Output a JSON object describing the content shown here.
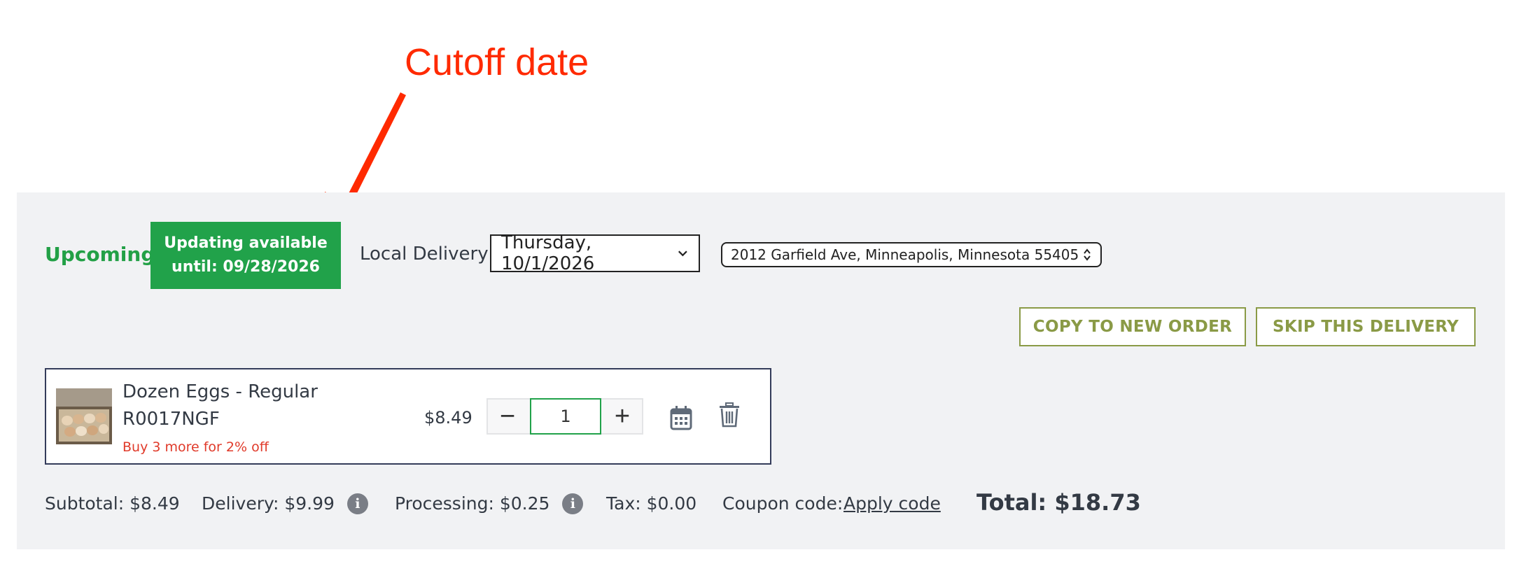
{
  "annotation": {
    "label": "Cutoff date",
    "color": "#ff2a00"
  },
  "order": {
    "status": "Upcoming",
    "cutoff_line1": "Updating available",
    "cutoff_line2": "until: 09/28/2026",
    "delivery_type": "Local Delivery",
    "delivery_date": "Thursday, 10/1/2026",
    "address": "2012 Garfield Ave, Minneapolis, Minnesota 55405"
  },
  "actions": {
    "copy_label": "COPY TO NEW ORDER",
    "skip_label": "SKIP THIS DELIVERY"
  },
  "item": {
    "name": "Dozen Eggs - Regular",
    "sku": "R0017NGF",
    "promo": "Buy 3 more for 2% off",
    "price": "$8.49",
    "quantity": "1",
    "minus": "−",
    "plus": "+"
  },
  "summary": {
    "subtotal": "Subtotal: $8.49",
    "delivery": "Delivery: $9.99",
    "processing": "Processing: $0.25",
    "tax": "Tax: $0.00",
    "coupon_label": "Coupon code:",
    "coupon_link": "Apply code",
    "total": "Total: $18.73",
    "info_glyph": "i"
  },
  "colors": {
    "brand_green": "#21a24a",
    "olive": "#8a9a46",
    "promo_red": "#e03a2a",
    "panel": "#f1f2f4"
  }
}
